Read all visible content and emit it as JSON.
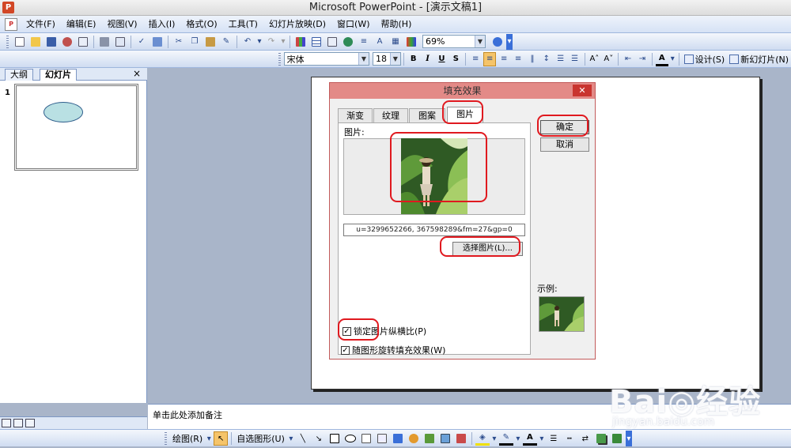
{
  "window": {
    "title": "Microsoft PowerPoint - [演示文稿1]"
  },
  "menu": [
    "文件(F)",
    "编辑(E)",
    "视图(V)",
    "插入(I)",
    "格式(O)",
    "工具(T)",
    "幻灯片放映(D)",
    "窗口(W)",
    "帮助(H)"
  ],
  "standard_toolbar": {
    "zoom": "69%"
  },
  "format_toolbar": {
    "font": "宋体",
    "size": "18",
    "bold": "B",
    "italic": "I",
    "underline": "U",
    "shadow": "S",
    "font_color": "A",
    "design": "设计(S)",
    "new_slide": "新幻灯片(N)"
  },
  "left_pane": {
    "tab_outline": "大纲",
    "tab_slides": "幻灯片",
    "close": "×",
    "slide_number": "1"
  },
  "dialog": {
    "title": "填充效果",
    "close": "✕",
    "tabs": [
      "渐变",
      "纹理",
      "图案",
      "图片"
    ],
    "active_tab": "图片",
    "picture_label": "图片:",
    "filename": "u=3299652266, 367598289&fm=27&gp=0",
    "select_picture": "选择图片(L)...",
    "lock_aspect": "锁定图片纵横比(P)",
    "rotate_with_shape": "随图形旋转填充效果(W)",
    "ok": "确定",
    "cancel": "取消",
    "sample_label": "示例:"
  },
  "notes": {
    "placeholder": "单击此处添加备注"
  },
  "drawing_toolbar": {
    "draw": "绘图(R)",
    "autoshapes": "自选图形(U)"
  },
  "watermark": {
    "logo": "Bai◎经验",
    "site": "jingyan.baidu.com"
  },
  "colors": {
    "highlight": "#e0191f",
    "dialog_title": "#e38a87",
    "close_button": "#c9342f"
  }
}
